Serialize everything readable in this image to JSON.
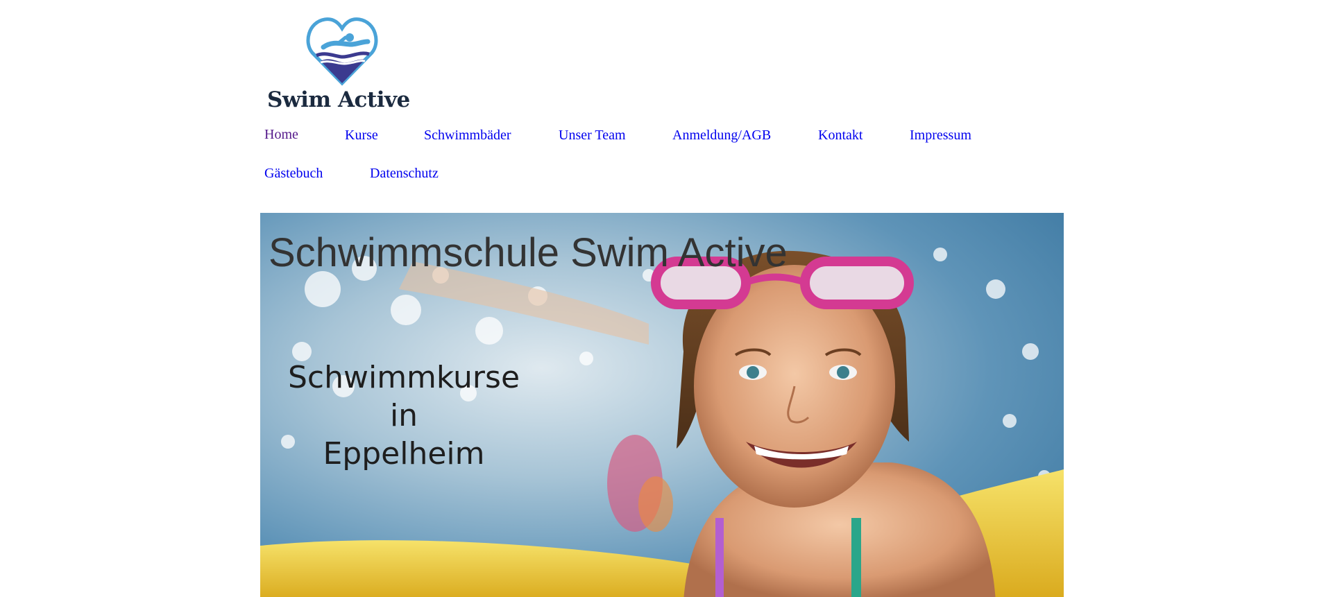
{
  "logo": {
    "text": "Swim Active",
    "icon": "swimmer-heart-logo",
    "colors": {
      "heart_light": "#4aa3d8",
      "heart_dark": "#3b3a8f",
      "text": "#1b2a3f"
    }
  },
  "nav": {
    "row1": [
      {
        "label": "Home",
        "visited": true
      },
      {
        "label": "Kurse"
      },
      {
        "label": "Schwimmbäder"
      },
      {
        "label": "Unser Team"
      },
      {
        "label": "Anmeldung/AGB"
      },
      {
        "label": "Kontakt"
      },
      {
        "label": "Impressum"
      }
    ],
    "row2": [
      {
        "label": "Gästebuch"
      },
      {
        "label": "Datenschutz"
      }
    ],
    "link_color": "#0000ee",
    "visited_color": "#551a8b"
  },
  "hero": {
    "title": "Schwimmschule Swim Active",
    "subtitle_line1": "Schwimmkurse in",
    "subtitle_line2": "Eppelheim",
    "image": "girl-with-pink-goggles-in-pool"
  }
}
